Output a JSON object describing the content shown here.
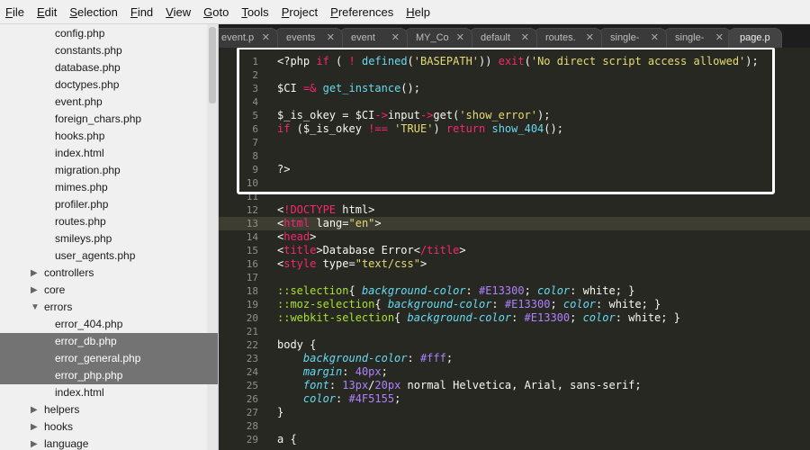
{
  "menu": [
    "File",
    "Edit",
    "Selection",
    "Find",
    "View",
    "Goto",
    "Tools",
    "Project",
    "Preferences",
    "Help"
  ],
  "sidebar": {
    "files_top": [
      "config.php",
      "constants.php",
      "database.php",
      "doctypes.php",
      "event.php",
      "foreign_chars.php",
      "hooks.php",
      "index.html",
      "migration.php",
      "mimes.php",
      "profiler.php",
      "routes.php",
      "smileys.php",
      "user_agents.php"
    ],
    "folders_a": [
      "controllers",
      "core"
    ],
    "errors_folder": "errors",
    "error_files": [
      "error_404.php",
      "error_db.php",
      "error_general.php",
      "error_php.php",
      "index.html"
    ],
    "folders_b": [
      "helpers",
      "hooks",
      "language"
    ],
    "selected": [
      "error_db.php",
      "error_general.php",
      "error_php.php"
    ]
  },
  "tabs": [
    "event.p",
    "events",
    "event",
    "MY_Co",
    "default",
    "routes.",
    "single-",
    "single-",
    "page.p"
  ],
  "editor": {
    "current_line": 13,
    "lines": [
      {
        "n": "1",
        "code": "<?php if ( ! defined('BASEPATH')) exit('No direct script access allowed');"
      },
      {
        "n": "2",
        "code": ""
      },
      {
        "n": "3",
        "code": "$CI =& get_instance();"
      },
      {
        "n": "4",
        "code": ""
      },
      {
        "n": "5",
        "code": "$_is_okey = $CI->input->get('show_error');"
      },
      {
        "n": "6",
        "code": "if ($_is_okey !== 'TRUE') return show_404();"
      },
      {
        "n": "7",
        "code": ""
      },
      {
        "n": "8",
        "code": ""
      },
      {
        "n": "9",
        "code": "?>"
      },
      {
        "n": "10",
        "code": ""
      },
      {
        "n": "11",
        "code": ""
      },
      {
        "n": "12",
        "code": "<!DOCTYPE html>"
      },
      {
        "n": "13",
        "code": "<html lang=\"en\">"
      },
      {
        "n": "14",
        "code": "<head>"
      },
      {
        "n": "15",
        "code": "<title>Database Error</title>"
      },
      {
        "n": "16",
        "code": "<style type=\"text/css\">"
      },
      {
        "n": "17",
        "code": ""
      },
      {
        "n": "18",
        "code": "::selection{ background-color: #E13300; color: white; }"
      },
      {
        "n": "19",
        "code": "::moz-selection{ background-color: #E13300; color: white; }"
      },
      {
        "n": "20",
        "code": "::webkit-selection{ background-color: #E13300; color: white; }"
      },
      {
        "n": "21",
        "code": ""
      },
      {
        "n": "22",
        "code": "body {"
      },
      {
        "n": "23",
        "code": "    background-color: #fff;"
      },
      {
        "n": "24",
        "code": "    margin: 40px;"
      },
      {
        "n": "25",
        "code": "    font: 13px/20px normal Helvetica, Arial, sans-serif;"
      },
      {
        "n": "26",
        "code": "    color: #4F5155;"
      },
      {
        "n": "27",
        "code": "}"
      },
      {
        "n": "28",
        "code": ""
      },
      {
        "n": "29",
        "code": "a {"
      }
    ]
  },
  "colors": {
    "editor_bg": "#272822",
    "highlight": "#ffffff",
    "sidebar_selected": "#737373"
  }
}
